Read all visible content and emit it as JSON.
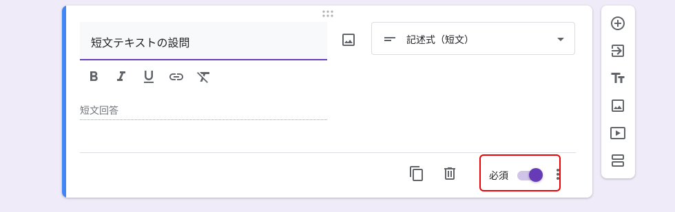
{
  "question": {
    "title": "短文テキストの設問",
    "answer_hint": "短文回答",
    "type_label": "記述式（短文）",
    "required_label": "必須",
    "required": true
  },
  "icons": {
    "image": "image-icon",
    "type": "short-text-lines-icon",
    "dropdown": "dropdown-arrow-icon",
    "bold": "bold-icon",
    "italic": "italic-icon",
    "underline": "underline-icon",
    "link": "link-icon",
    "clear_format": "clear-format-icon",
    "copy": "copy-icon",
    "delete": "trash-icon",
    "more": "more-vert-icon"
  },
  "side_toolbar": {
    "items": [
      "add-question-icon",
      "import-questions-icon",
      "add-title-icon",
      "add-image-icon",
      "add-video-icon",
      "add-section-icon"
    ]
  },
  "colors": {
    "accent": "#4285f4",
    "primary": "#673ab7",
    "background": "#f0ebf8",
    "highlight": "#e00000"
  }
}
